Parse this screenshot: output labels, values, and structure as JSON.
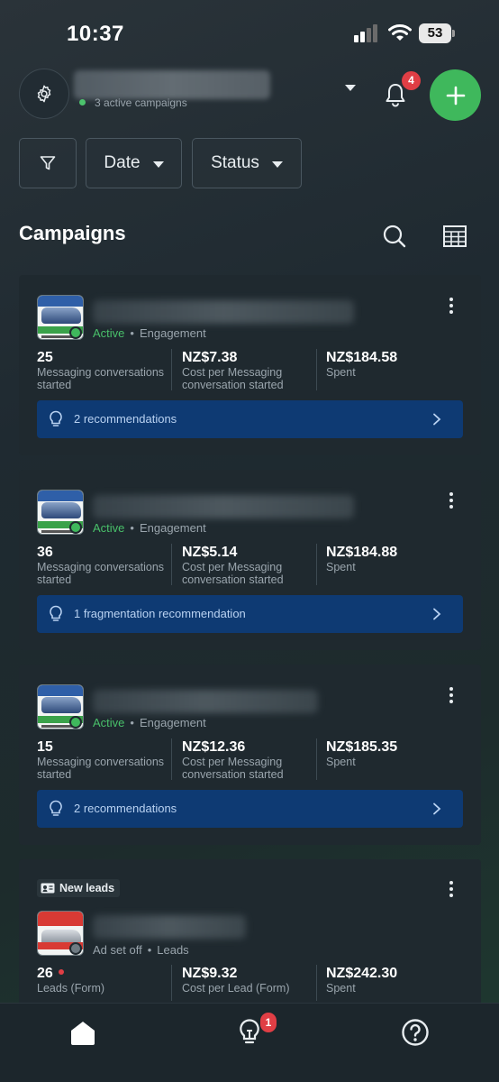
{
  "status_bar": {
    "time": "10:37",
    "battery": "53"
  },
  "header": {
    "account_subtitle": "3 active campaigns",
    "notifications_count": "4",
    "icons": {
      "settings": "gear-icon",
      "notifications": "bell-icon",
      "create": "plus-icon"
    }
  },
  "filters": {
    "filter_icon": "funnel-icon",
    "date_label": "Date",
    "status_label": "Status"
  },
  "campaigns": {
    "title": "Campaigns",
    "cards": [
      {
        "status": "Active",
        "objective": "Engagement",
        "metrics": [
          {
            "value": "25",
            "label": "Messaging conversations started"
          },
          {
            "value": "NZ$7.38",
            "label": "Cost per Messaging conversation started"
          },
          {
            "value": "NZ$184.58",
            "label": "Spent"
          }
        ],
        "recommendation": "2 recommendations"
      },
      {
        "status": "Active",
        "objective": "Engagement",
        "metrics": [
          {
            "value": "36",
            "label": "Messaging conversations started"
          },
          {
            "value": "NZ$5.14",
            "label": "Cost per Messaging conversation started"
          },
          {
            "value": "NZ$184.88",
            "label": "Spent"
          }
        ],
        "recommendation": "1 fragmentation recommendation"
      },
      {
        "status": "Active",
        "objective": "Engagement",
        "metrics": [
          {
            "value": "15",
            "label": "Messaging conversations started"
          },
          {
            "value": "NZ$12.36",
            "label": "Cost per Messaging conversation started"
          },
          {
            "value": "NZ$185.35",
            "label": "Spent"
          }
        ],
        "recommendation": "2 recommendations"
      },
      {
        "tag": "New leads",
        "status": "Ad set off",
        "objective": "Leads",
        "metrics": [
          {
            "value": "26",
            "label": "Leads (Form)"
          },
          {
            "value": "NZ$9.32",
            "label": "Cost per Lead (Form)"
          },
          {
            "value": "NZ$242.30",
            "label": "Spent"
          }
        ]
      }
    ]
  },
  "bottom_nav": {
    "items": [
      "home-icon",
      "lightbulb-icon",
      "help-icon"
    ],
    "recommendations_badge": "1"
  },
  "colors": {
    "accent_green": "#3fb85c",
    "badge_red": "#e03e45",
    "rec_blue": "#0e3a73",
    "card_bg": "#1f292f"
  }
}
